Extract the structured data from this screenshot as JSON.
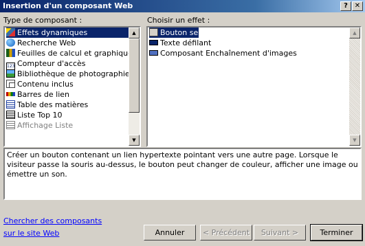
{
  "window": {
    "title": "Insertion d'un composant Web",
    "help_label": "?",
    "close_label": "✕"
  },
  "left_panel": {
    "label": "Type de composant :",
    "items": [
      {
        "label": "Effets dynamiques",
        "icon": "effects-icon",
        "selected": true
      },
      {
        "label": "Recherche Web",
        "icon": "globe-search-icon"
      },
      {
        "label": "Feuilles de calcul et graphique",
        "icon": "spreadsheet-chart-icon"
      },
      {
        "label": "Compteur d'accès",
        "icon": "counter-icon"
      },
      {
        "label": "Bibliothèque de photographie",
        "icon": "photo-library-icon"
      },
      {
        "label": "Contenu inclus",
        "icon": "included-content-icon"
      },
      {
        "label": "Barres de lien",
        "icon": "link-bar-icon"
      },
      {
        "label": "Table des matières",
        "icon": "table-of-contents-icon"
      },
      {
        "label": "Liste Top 10",
        "icon": "top10-list-icon"
      },
      {
        "label": "Affichage Liste",
        "icon": "list-view-icon",
        "dimmed": true
      }
    ]
  },
  "right_panel": {
    "label": "Choisir un effet :",
    "items": [
      {
        "label": "Bouton sensitif",
        "icon": "hover-button-icon",
        "selected": true
      },
      {
        "label": "Texte défilant",
        "icon": "marquee-icon"
      },
      {
        "label": "Composant Enchaînement d'images",
        "icon": "banner-ad-icon"
      }
    ]
  },
  "description": "Créer un bouton contenant un lien hypertexte pointant vers une autre page. Lorsque le visiteur passe la souris au-dessus, le bouton peut changer de couleur, afficher une image ou émettre un son.",
  "footer": {
    "link_line1": "Chercher des composants",
    "link_line2": "sur le site Web",
    "cancel_label": "Annuler",
    "prev_label": "< Précédent",
    "next_label": "Suivant >",
    "finish_label": "Terminer"
  },
  "colors": {
    "title_bar": "#0a246a",
    "selection": "#0a246a",
    "face": "#d4d0c8",
    "link": "#0000ff"
  }
}
